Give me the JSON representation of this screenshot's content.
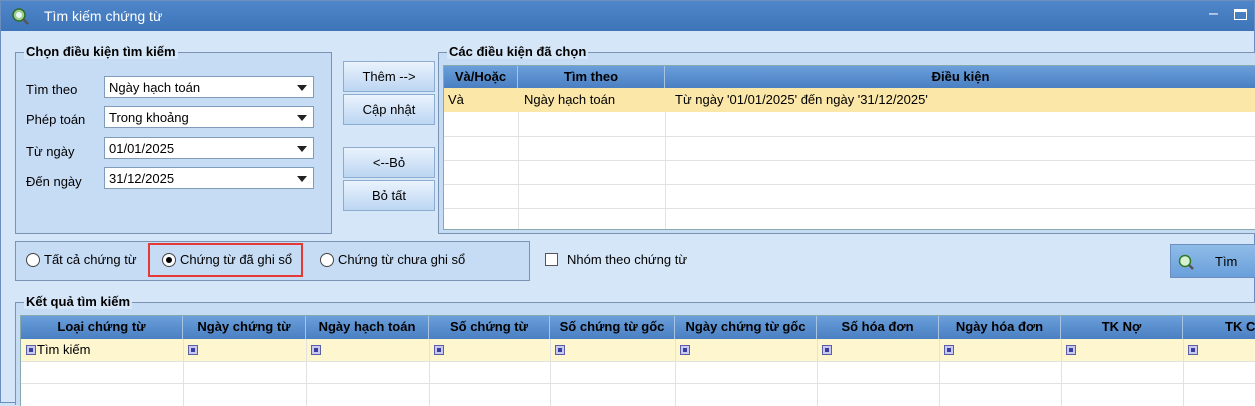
{
  "window": {
    "title": "Tìm kiếm chứng từ"
  },
  "criteria": {
    "legend": "Chọn điều kiện tìm kiếm",
    "search_by_label": "Tìm theo",
    "search_by_value": "Ngày hạch toán",
    "operator_label": "Phép toán",
    "operator_value": "Trong khoảng",
    "from_label": "Từ ngày",
    "from_value": "01/01/2025",
    "to_label": "Đến ngày",
    "to_value": "31/12/2025"
  },
  "buttons": {
    "add": "Thêm -->",
    "update": "Cập nhật",
    "remove": "<--Bỏ",
    "remove_all": "Bỏ tất",
    "search": "Tìm"
  },
  "selected": {
    "legend": "Các điều kiện đã chọn",
    "columns": [
      "Và/Hoặc",
      "Tìm theo",
      "Điều kiện"
    ],
    "rows": [
      [
        "Và",
        "Ngày hạch toán",
        "Từ ngày '01/01/2025' đến ngày '31/12/2025'"
      ]
    ]
  },
  "filter": {
    "all": "Tất cả chứng từ",
    "posted": "Chứng từ đã ghi sổ",
    "unposted": "Chứng từ chưa ghi sổ",
    "selected": "posted",
    "group_label": "Nhóm theo chứng từ",
    "group_checked": false,
    "highlight_color": "#e53935"
  },
  "results": {
    "legend": "Kết quả tìm kiếm",
    "columns": [
      "Loại chứng từ",
      "Ngày chứng từ",
      "Ngày hạch toán",
      "Số chứng từ",
      "Số chứng từ gốc",
      "Ngày chứng từ gốc",
      "Số hóa đơn",
      "Ngày hóa đơn",
      "TK Nợ",
      "TK C"
    ],
    "filter_row_first": "Tìm kiếm"
  },
  "colors": {
    "title_bar": "#4a80c4",
    "header": "#5b8fd2",
    "selected_row": "#fbe7a8",
    "filter_row": "#fdf6cf"
  }
}
